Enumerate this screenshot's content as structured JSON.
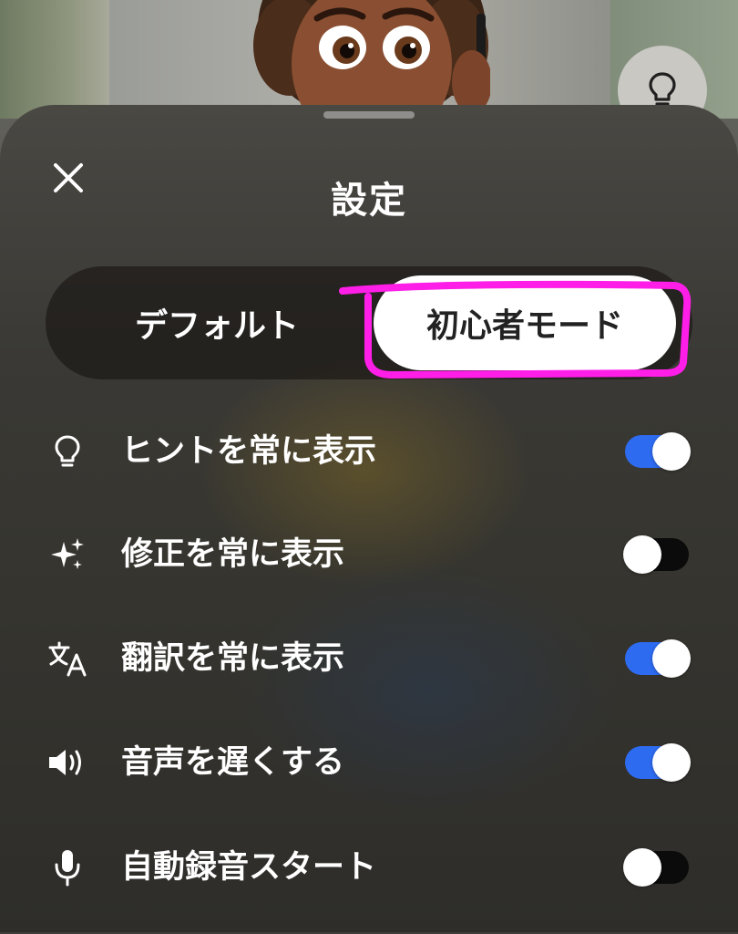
{
  "sheet": {
    "title": "設定",
    "close_icon": "close-icon",
    "grabber": "drag-handle"
  },
  "floating_hint_icon": "lightbulb-icon",
  "mode_selector": {
    "options": [
      {
        "label": "デフォルト",
        "selected": false
      },
      {
        "label": "初心者モード",
        "selected": true
      }
    ],
    "highlight_color": "#ff1ee8"
  },
  "settings": [
    {
      "label": "ヒントを常に表示",
      "icon": "lightbulb-icon",
      "enabled": true
    },
    {
      "label": "修正を常に表示",
      "icon": "sparkles-icon",
      "enabled": false
    },
    {
      "label": "翻訳を常に表示",
      "icon": "translate-icon",
      "enabled": true
    },
    {
      "label": "音声を遅くする",
      "icon": "speaker-icon",
      "enabled": true
    },
    {
      "label": "自動録音スタート",
      "icon": "microphone-icon",
      "enabled": false
    }
  ],
  "colors": {
    "toggle_on": "#2d6bf0",
    "toggle_off": "#0b0b0b",
    "text": "#ffffff"
  }
}
